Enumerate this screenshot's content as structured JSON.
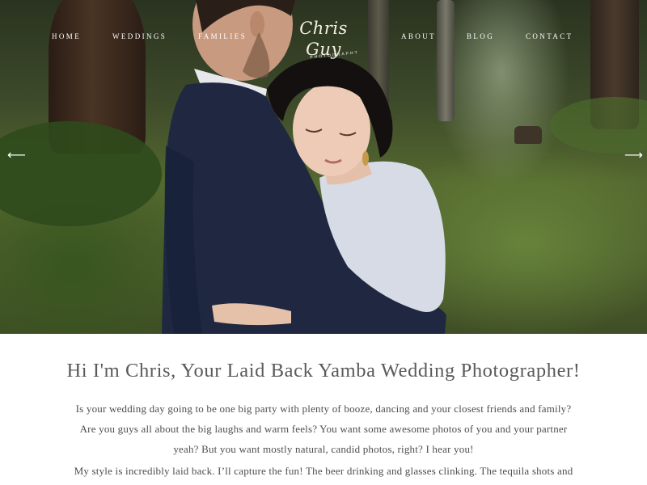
{
  "nav": {
    "left": [
      {
        "label": "HOME"
      },
      {
        "label": "WEDDINGS"
      },
      {
        "label": "FAMILIES"
      }
    ],
    "right": [
      {
        "label": "ABOUT"
      },
      {
        "label": "BLOG"
      },
      {
        "label": "CONTACT"
      }
    ]
  },
  "logo": {
    "script": "Chris Guy",
    "sub": "PHOTOGRAPHY"
  },
  "hero": {
    "prev_glyph": "⟵",
    "next_glyph": "⟶",
    "image_description": "Couple embracing in a forest"
  },
  "intro": {
    "headline": "Hi I'm Chris, Your Laid Back Yamba Wedding Photographer!",
    "paragraph1": "Is your wedding day going to be one big party with plenty of booze, dancing and your closest friends and family?  Are you guys all about the big laughs and warm feels?  You want some awesome photos of you and your partner yeah?  But you want mostly natural, candid photos, right?  I hear you!",
    "paragraph2": "My style is incredibly laid back.  I’ll capture the fun!  The beer drinking and glasses clinking.  The tequila shots and"
  },
  "colors": {
    "text": "#4e4e4e",
    "headline": "#5a5a5a",
    "nav": "#ffffff"
  }
}
